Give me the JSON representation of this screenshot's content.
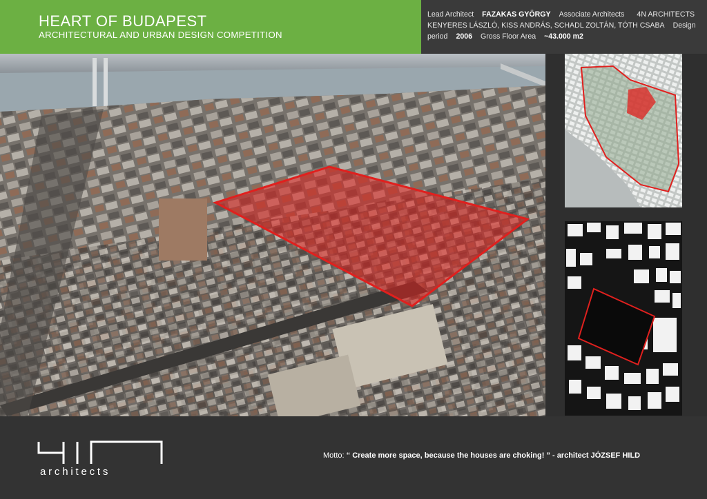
{
  "header": {
    "title": "HEART OF BUDAPEST",
    "subtitle": "ARCHITECTURAL AND URBAN DESIGN COMPETITION"
  },
  "credits": {
    "lead_label": "Lead Architect",
    "lead_name": "FAZAKAS GYÖRGY",
    "associate_label": "Associate Architects",
    "firm": "4N ARCHITECTS",
    "associates": "KENYERES LÁSZLÓ, KISS ANDRÁS, SCHADL ZOLTÁN, TÓTH CSABA",
    "design_label": "Design",
    "period_label": "period",
    "period_value": "2006",
    "area_label": "Gross Floor Area",
    "area_value": "~43.000 m2"
  },
  "logo": {
    "text": "architects",
    "alt": "4n architects logo"
  },
  "motto": {
    "label": "Motto:",
    "quote": "“ Create more space, because the houses are choking! ” - architect JÓZSEF HILD"
  },
  "colors": {
    "accent_green": "#6cb043",
    "highlight_red": "#e0201e",
    "background": "#333333"
  },
  "images": {
    "aerial": "aerial-photo-budapest-with-site-highlight",
    "map_top": "district-context-map",
    "map_bottom": "figure-ground-plan"
  }
}
